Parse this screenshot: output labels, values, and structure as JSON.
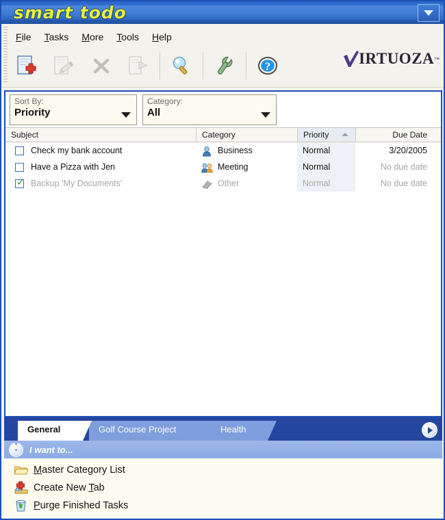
{
  "window": {
    "title": "smart todo",
    "title_menu_icon": "chevron-down-icon"
  },
  "menubar": {
    "items": [
      {
        "label": "File",
        "accel": "F"
      },
      {
        "label": "Tasks",
        "accel": "T"
      },
      {
        "label": "More",
        "accel": "M"
      },
      {
        "label": "Tools",
        "accel": "T"
      },
      {
        "label": "Help",
        "accel": "H"
      }
    ]
  },
  "toolbar": {
    "buttons": [
      {
        "name": "new-task-button",
        "icon": "page-plus-icon",
        "enabled": true
      },
      {
        "name": "edit-task-button",
        "icon": "page-pencil-icon",
        "enabled": false
      },
      {
        "name": "delete-task-button",
        "icon": "x-cross-icon",
        "enabled": false
      },
      {
        "name": "move-task-button",
        "icon": "page-arrow-icon",
        "enabled": false
      },
      {
        "name": "find-button",
        "icon": "magnifier-icon",
        "enabled": true
      },
      {
        "name": "options-button",
        "icon": "wrench-icon",
        "enabled": true
      },
      {
        "name": "help-button",
        "icon": "question-mark-icon",
        "enabled": true
      }
    ]
  },
  "brand": {
    "name": "IRTUOZA",
    "mark": "v-checkmark-icon",
    "tm": "™"
  },
  "filters": {
    "sort_by": {
      "label": "Sort By:",
      "value": "Priority"
    },
    "category": {
      "label": "Category:",
      "value": "All"
    }
  },
  "task_list": {
    "columns": [
      {
        "key": "subject",
        "label": "Subject"
      },
      {
        "key": "category",
        "label": "Category"
      },
      {
        "key": "priority",
        "label": "Priority",
        "sorted": true,
        "sort_dir": "asc"
      },
      {
        "key": "due",
        "label": "Due Date"
      }
    ],
    "rows": [
      {
        "checked": false,
        "subject": "Check my bank account",
        "category": "Business",
        "category_icon": "person-blue-icon",
        "priority": "Normal",
        "due": "3/20/2005",
        "completed": false
      },
      {
        "checked": false,
        "subject": "Have a Pizza with Jen",
        "category": "Meeting",
        "category_icon": "two-people-icon",
        "priority": "Normal",
        "due": "No due date",
        "completed": false
      },
      {
        "checked": true,
        "subject": "Backup 'My Documents'",
        "category": "Other",
        "category_icon": "scribble-gray-icon",
        "priority": "Normal",
        "due": "No due date",
        "completed": true
      }
    ]
  },
  "tabs": {
    "items": [
      {
        "label": "General",
        "active": true
      },
      {
        "label": "Golf Course Project",
        "active": false
      },
      {
        "label": "Health",
        "active": false
      }
    ],
    "scroll_icon": "chevron-right-icon"
  },
  "want_panel": {
    "header": "I want to...",
    "header_icon": "double-chevron-down-icon",
    "actions": [
      {
        "label_before": "",
        "accel": "M",
        "label_after": "aster Category List",
        "icon": "folder-icon",
        "name": "master-category-list"
      },
      {
        "label_before": "Create New ",
        "accel": "T",
        "label_after": "ab",
        "icon": "add-tab-icon",
        "name": "create-new-tab"
      },
      {
        "label_before": "",
        "accel": "P",
        "label_after": "urge Finished Tasks",
        "icon": "recycle-bin-icon",
        "name": "purge-finished-tasks"
      }
    ]
  },
  "colors": {
    "title_blue": "#2f66c4",
    "accent_blue": "#1c4fb5",
    "title_yellow": "#e8f23c",
    "tab_bar": "#24469f",
    "want_bar": "#8cabe4",
    "panel_cream": "#fdfbef",
    "sorted_col": "#eef1f5",
    "dim_text": "#a6a6a6"
  }
}
